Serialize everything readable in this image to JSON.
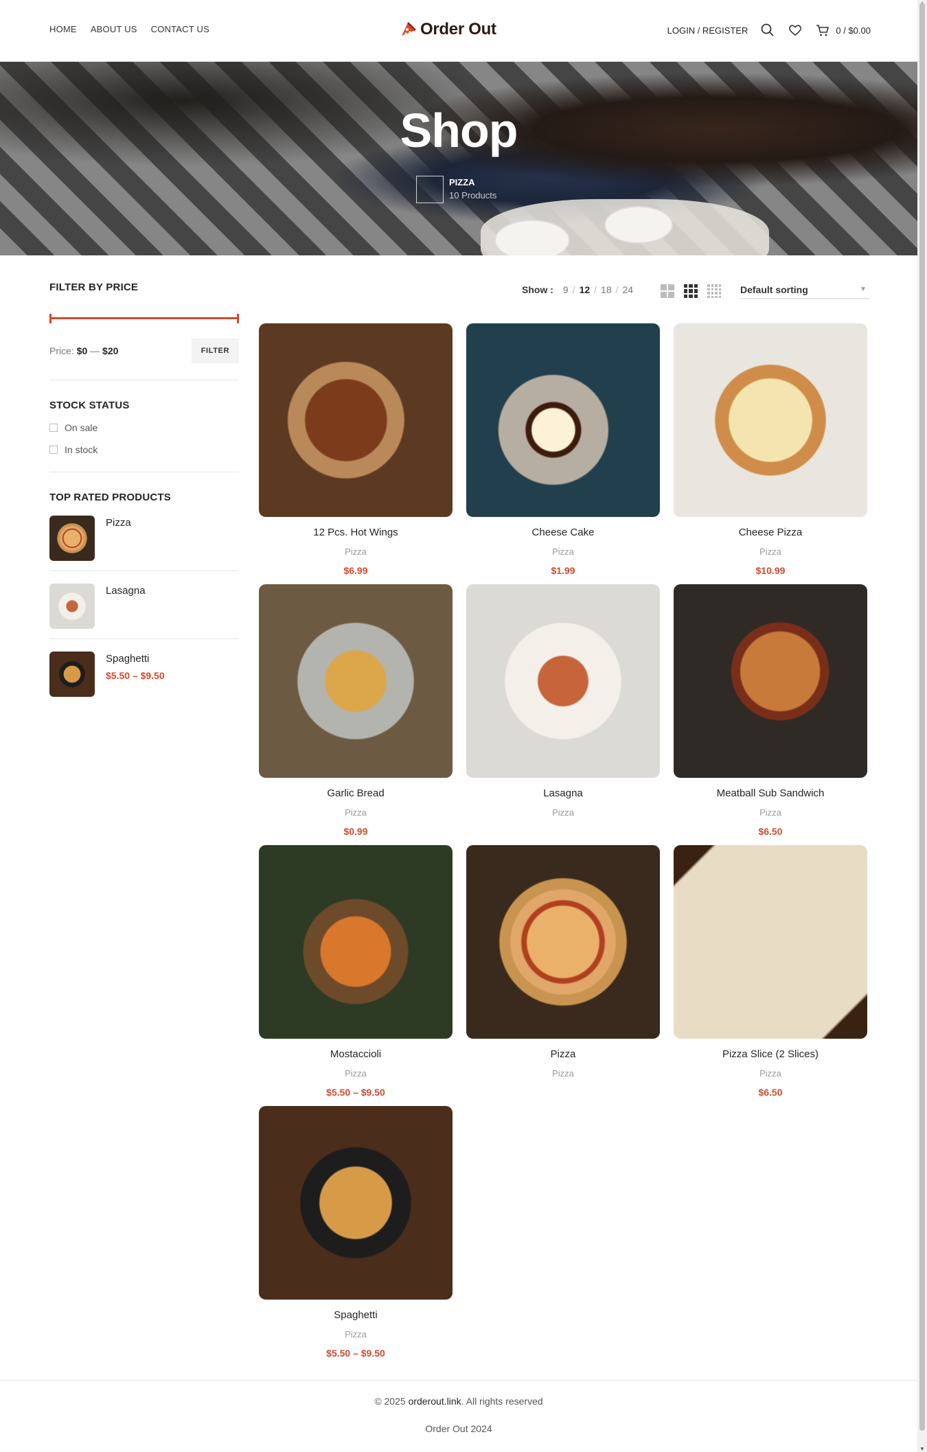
{
  "header": {
    "nav_left": [
      "HOME",
      "ABOUT US",
      "CONTACT US"
    ],
    "logo_text": "Order Out",
    "login": "LOGIN / REGISTER",
    "cart": "0 / $0.00"
  },
  "hero": {
    "title": "Shop",
    "category_name": "PIZZA",
    "category_count": "10 Products"
  },
  "sidebar": {
    "price_title": "FILTER BY PRICE",
    "price_label": "Price:",
    "price_min": "$0",
    "price_dash": "—",
    "price_max": "$20",
    "filter_button": "FILTER",
    "stock_title": "STOCK STATUS",
    "stock_options": [
      "On sale",
      "In stock"
    ],
    "top_rated_title": "TOP RATED PRODUCTS",
    "top_rated": [
      {
        "name": "Pizza",
        "price": ""
      },
      {
        "name": "Lasagna",
        "price": ""
      },
      {
        "name": "Spaghetti",
        "price": "$5.50 – $9.50"
      }
    ]
  },
  "toolbar": {
    "show_label": "Show :",
    "per_page": [
      "9",
      "12",
      "18",
      "24"
    ],
    "per_page_active": "12",
    "sorting": "Default sorting"
  },
  "products": [
    {
      "name": "12 Pcs. Hot Wings",
      "category": "Pizza",
      "price": "$6.99"
    },
    {
      "name": "Cheese Cake",
      "category": "Pizza",
      "price": "$1.99"
    },
    {
      "name": "Cheese Pizza",
      "category": "Pizza",
      "price": "$10.99"
    },
    {
      "name": "Garlic Bread",
      "category": "Pizza",
      "price": "$0.99"
    },
    {
      "name": "Lasagna",
      "category": "Pizza",
      "price": ""
    },
    {
      "name": "Meatball Sub Sandwich",
      "category": "Pizza",
      "price": "$6.50"
    },
    {
      "name": "Mostaccioli",
      "category": "Pizza",
      "price": "$5.50 – $9.50"
    },
    {
      "name": "Pizza",
      "category": "Pizza",
      "price": ""
    },
    {
      "name": "Pizza Slice (2 Slices)",
      "category": "Pizza",
      "price": "$6.50"
    },
    {
      "name": "Spaghetti",
      "category": "Pizza",
      "price": "$5.50 – $9.50"
    }
  ],
  "footer": {
    "copyright_prefix": "© 2025",
    "copyright_site": "orderout.link",
    "copyright_suffix": ". All rights reserved",
    "tagline": "Order Out 2024"
  },
  "colors": {
    "accent": "#d14a2c",
    "text": "#242424"
  },
  "icons": [
    "pizza-logo-icon",
    "search-icon",
    "heart-icon",
    "cart-icon",
    "grid-2-icon",
    "grid-3-icon",
    "grid-4-icon",
    "chevron-down-icon"
  ]
}
